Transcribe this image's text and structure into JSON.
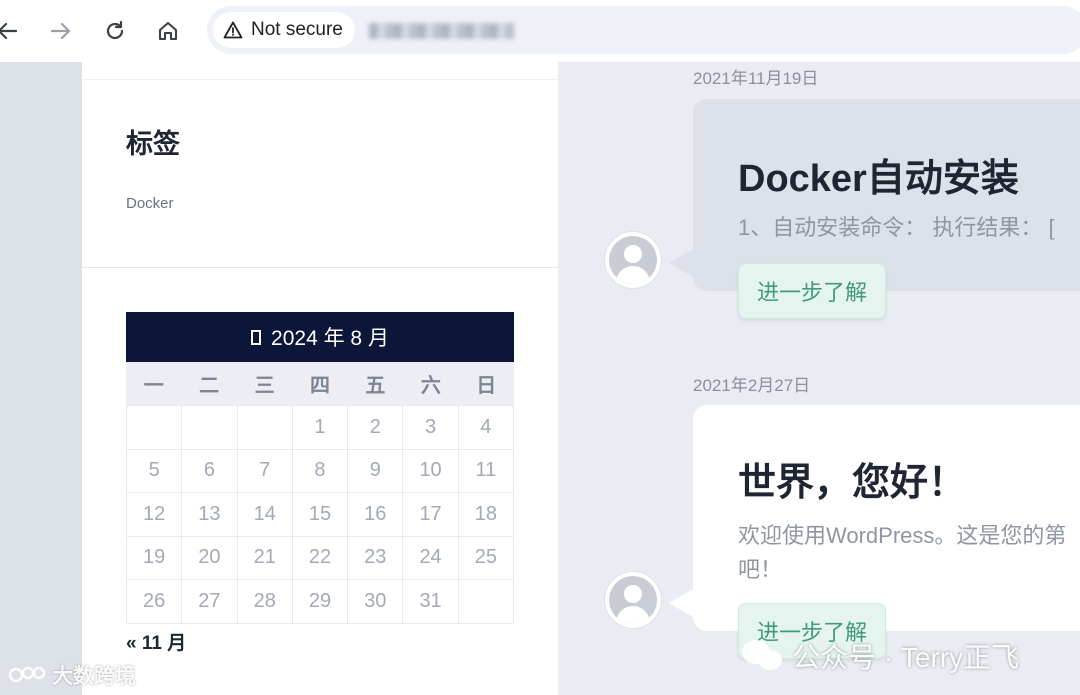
{
  "browser": {
    "security_label": "Not secure",
    "icons": [
      "back-arrow-icon",
      "forward-arrow-icon",
      "reload-icon",
      "home-icon",
      "warning-triangle-icon"
    ]
  },
  "sidebar": {
    "tags_title": "标签",
    "tags": [
      "Docker"
    ],
    "calendar": {
      "caption": "2024 年 8 月",
      "weekdays": [
        "一",
        "二",
        "三",
        "四",
        "五",
        "六",
        "日"
      ],
      "weeks": [
        [
          "",
          "",
          "",
          "1",
          "2",
          "3",
          "4"
        ],
        [
          "5",
          "6",
          "7",
          "8",
          "9",
          "10",
          "11"
        ],
        [
          "12",
          "13",
          "14",
          "15",
          "16",
          "17",
          "18"
        ],
        [
          "19",
          "20",
          "21",
          "22",
          "23",
          "24",
          "25"
        ],
        [
          "26",
          "27",
          "28",
          "29",
          "30",
          "31",
          ""
        ]
      ],
      "prev_link": "« 11 月"
    }
  },
  "posts": [
    {
      "date": "2021年11月19日",
      "title": "Docker自动安装",
      "excerpt": "1、自动安装命令： 执行结果： [",
      "more_label": "进一步了解"
    },
    {
      "date": "2021年2月27日",
      "title": "世界，您好！",
      "excerpt": "欢迎使用WordPress。这是您的第一篇文章。编辑或删除它，然后开始写作吧！",
      "excerpt_visible_line1": "欢迎使用WordPress。这是您的第",
      "excerpt_visible_line2": "吧！",
      "more_label": "进一步了解"
    }
  ],
  "watermarks": {
    "left": "大数跨境",
    "right": "公众号 · Terry正飞"
  },
  "colors": {
    "calendar_header": "#0b1638",
    "button_bg": "#e6f4ef",
    "button_text": "#3f9b7c",
    "page_bg": "#e9ecf2"
  }
}
